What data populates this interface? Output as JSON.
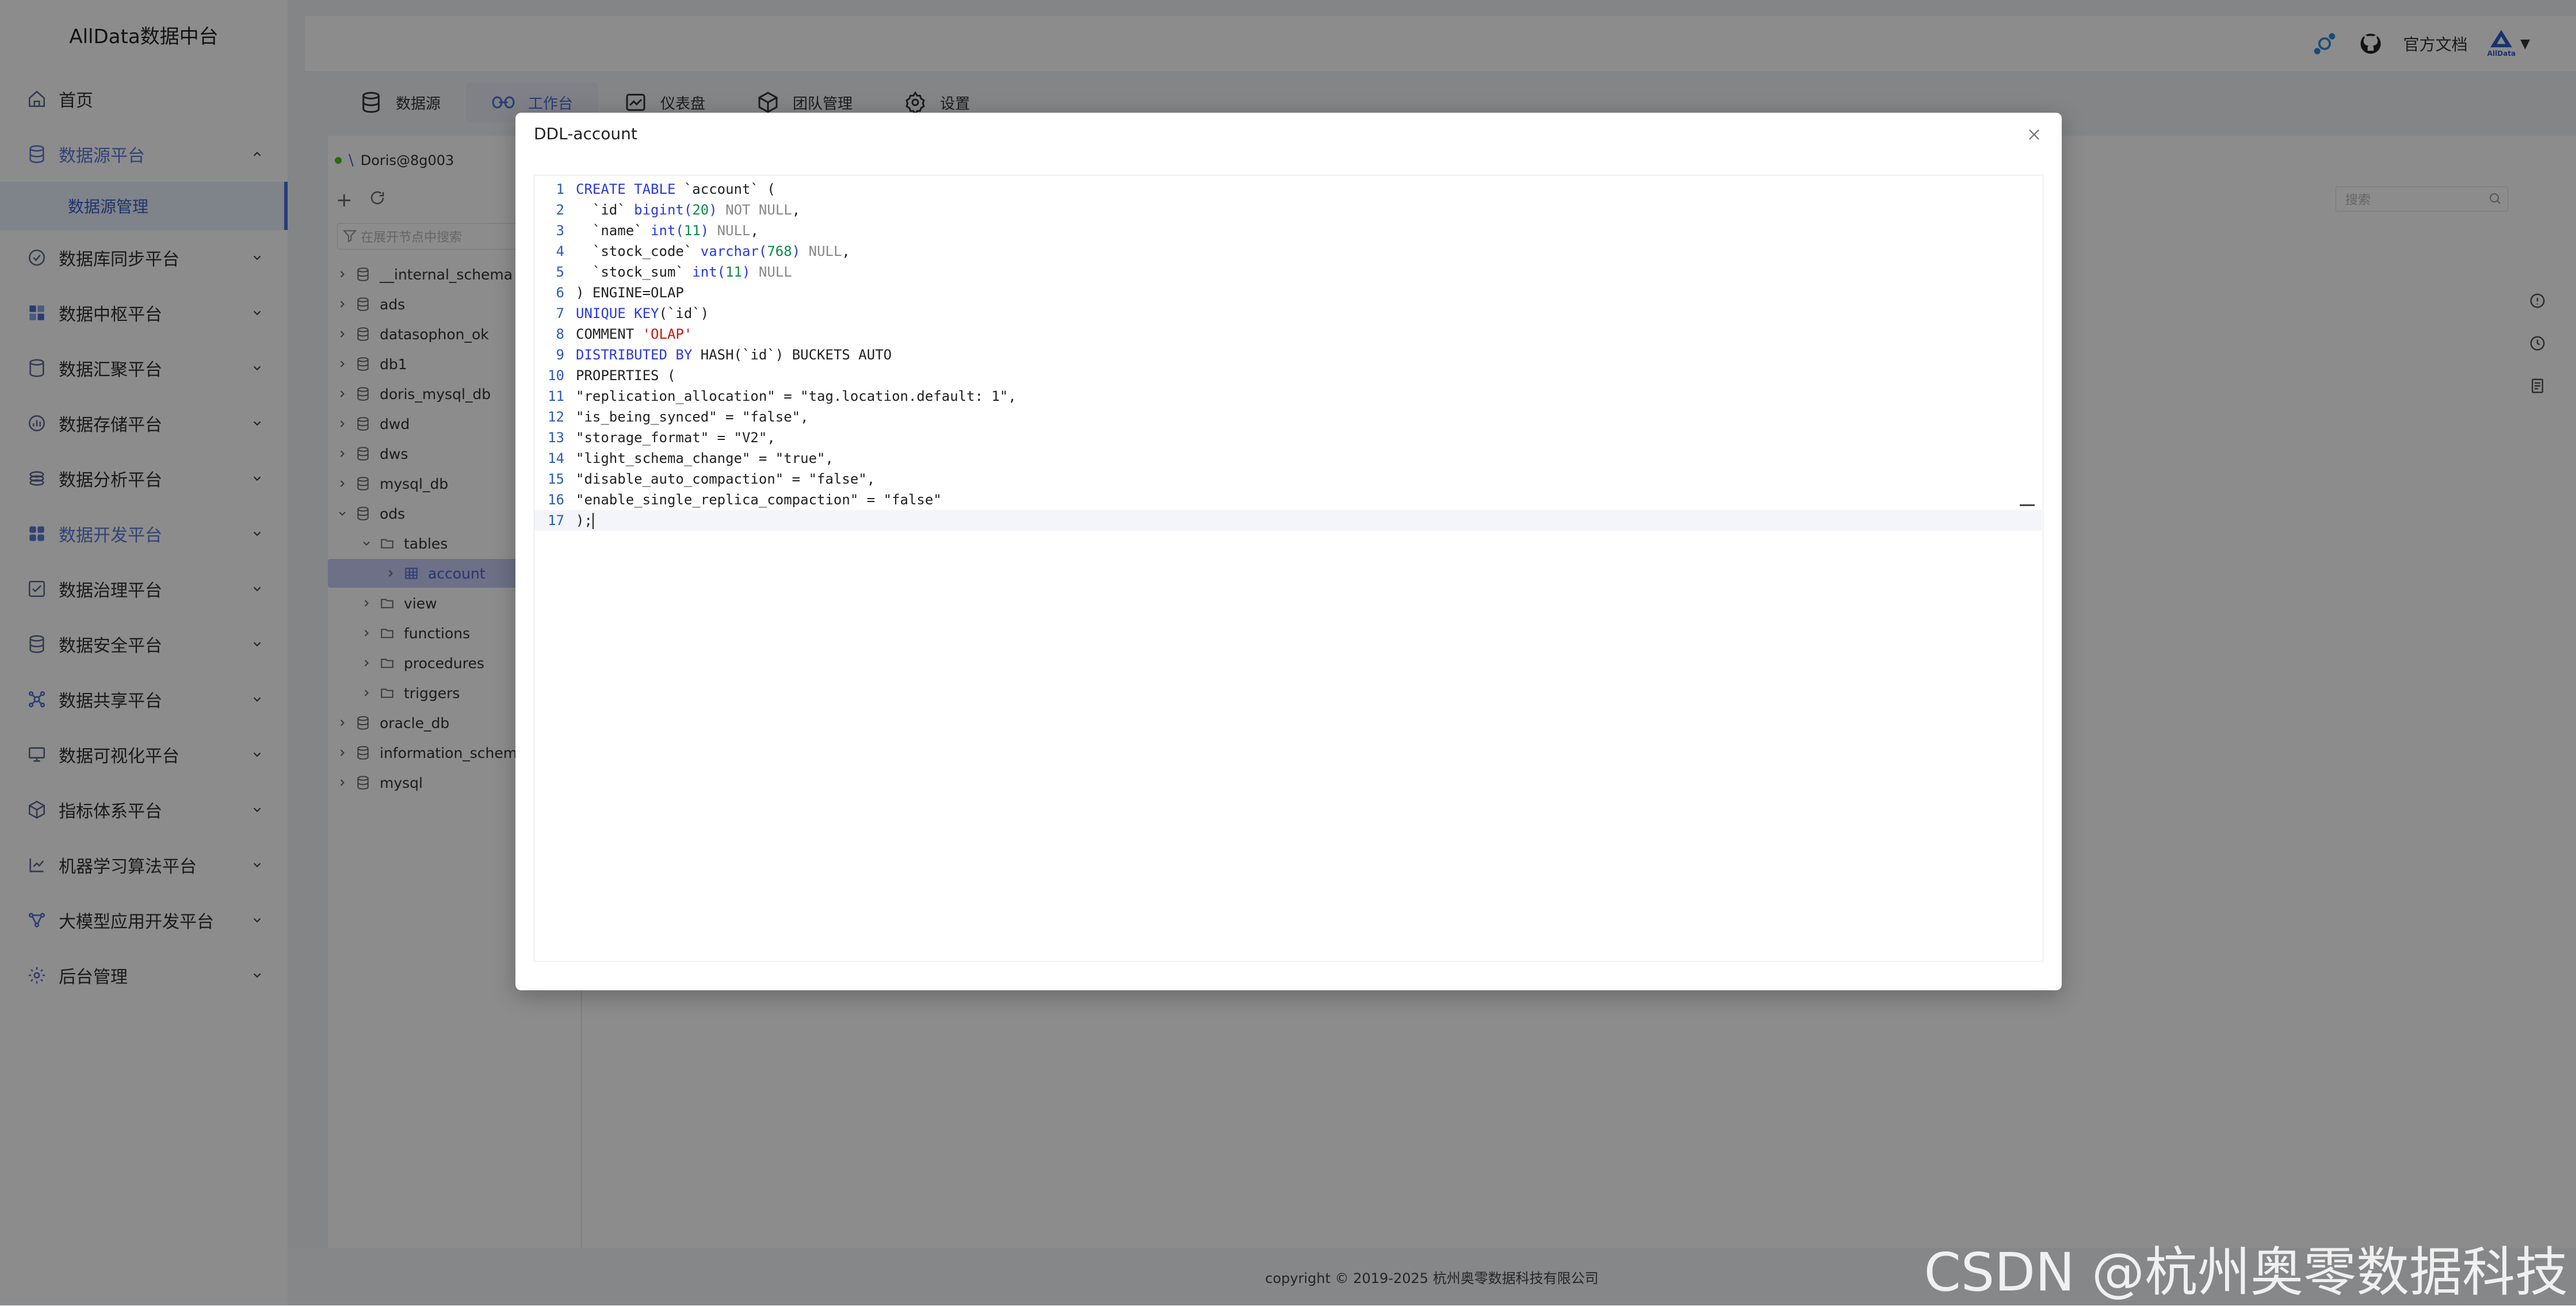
{
  "brand": "AllData数据中台",
  "sidebar": {
    "items": [
      {
        "label": "首页",
        "icon": "home-icon"
      },
      {
        "label": "数据源平台",
        "icon": "database-stack-icon",
        "expanded": true
      },
      {
        "label": "数据库同步平台",
        "icon": "sync-icon"
      },
      {
        "label": "数据中枢平台",
        "icon": "grid-icon"
      },
      {
        "label": "数据汇聚平台",
        "icon": "database-icon"
      },
      {
        "label": "数据存储平台",
        "icon": "storage-icon"
      },
      {
        "label": "数据分析平台",
        "icon": "analysis-icon"
      },
      {
        "label": "数据开发平台",
        "icon": "develop-icon"
      },
      {
        "label": "数据治理平台",
        "icon": "governance-icon"
      },
      {
        "label": "数据安全平台",
        "icon": "security-icon"
      },
      {
        "label": "数据共享平台",
        "icon": "share-icon"
      },
      {
        "label": "数据可视化平台",
        "icon": "monitor-icon"
      },
      {
        "label": "指标体系平台",
        "icon": "cube-icon"
      },
      {
        "label": "机器学习算法平台",
        "icon": "ml-icon"
      },
      {
        "label": "大模型应用开发平台",
        "icon": "network-icon"
      },
      {
        "label": "后台管理",
        "icon": "settings-icon"
      }
    ],
    "submenu": {
      "label": "数据源管理"
    }
  },
  "header": {
    "docs_label": "官方文档",
    "logo_text": "AllData"
  },
  "tabs": [
    {
      "label": "数据源",
      "icon": "database-icon"
    },
    {
      "label": "工作台",
      "icon": "workbench-icon",
      "active": true
    },
    {
      "label": "仪表盘",
      "icon": "dashboard-icon"
    },
    {
      "label": "团队管理",
      "icon": "team-icon"
    },
    {
      "label": "设置",
      "icon": "gear-icon"
    }
  ],
  "tree": {
    "connection": "Doris@8g003",
    "search_placeholder": "在展开节点中搜索",
    "nodes": [
      {
        "label": "__internal_schema",
        "level": 0,
        "open": false,
        "type": "db"
      },
      {
        "label": "ads",
        "level": 0,
        "open": false,
        "type": "db"
      },
      {
        "label": "datasophon_ok",
        "level": 0,
        "open": false,
        "type": "db"
      },
      {
        "label": "db1",
        "level": 0,
        "open": false,
        "type": "db"
      },
      {
        "label": "doris_mysql_db",
        "level": 0,
        "open": false,
        "type": "db"
      },
      {
        "label": "dwd",
        "level": 0,
        "open": false,
        "type": "db"
      },
      {
        "label": "dws",
        "level": 0,
        "open": false,
        "type": "db"
      },
      {
        "label": "mysql_db",
        "level": 0,
        "open": false,
        "type": "db"
      },
      {
        "label": "ods",
        "level": 0,
        "open": true,
        "type": "db"
      },
      {
        "label": "tables",
        "level": 1,
        "open": true,
        "type": "folder"
      },
      {
        "label": "account",
        "level": 2,
        "open": false,
        "type": "table",
        "selected": true
      },
      {
        "label": "view",
        "level": 1,
        "open": false,
        "type": "folder"
      },
      {
        "label": "functions",
        "level": 1,
        "open": false,
        "type": "folder"
      },
      {
        "label": "procedures",
        "level": 1,
        "open": false,
        "type": "folder"
      },
      {
        "label": "triggers",
        "level": 1,
        "open": false,
        "type": "folder"
      },
      {
        "label": "oracle_db",
        "level": 0,
        "open": false,
        "type": "db"
      },
      {
        "label": "information_schema",
        "level": 0,
        "open": false,
        "type": "db"
      },
      {
        "label": "mysql",
        "level": 0,
        "open": false,
        "type": "db"
      }
    ]
  },
  "content": {
    "search_placeholder": "搜索"
  },
  "footer": "copyright © 2019-2025 杭州奥零数据科技有限公司",
  "modal": {
    "title": "DDL-account",
    "code_lines": [
      {
        "n": "1",
        "t": "CREATE TABLE `account` ("
      },
      {
        "n": "2",
        "t": "  `id` bigint(20) NOT NULL,"
      },
      {
        "n": "3",
        "t": "  `name` int(11) NULL,"
      },
      {
        "n": "4",
        "t": "  `stock_code` varchar(768) NULL,"
      },
      {
        "n": "5",
        "t": "  `stock_sum` int(11) NULL"
      },
      {
        "n": "6",
        "t": ") ENGINE=OLAP"
      },
      {
        "n": "7",
        "t": "UNIQUE KEY(`id`)"
      },
      {
        "n": "8",
        "t": "COMMENT 'OLAP'"
      },
      {
        "n": "9",
        "t": "DISTRIBUTED BY HASH(`id`) BUCKETS AUTO"
      },
      {
        "n": "10",
        "t": "PROPERTIES ("
      },
      {
        "n": "11",
        "t": "\"replication_allocation\" = \"tag.location.default: 1\","
      },
      {
        "n": "12",
        "t": "\"is_being_synced\" = \"false\","
      },
      {
        "n": "13",
        "t": "\"storage_format\" = \"V2\","
      },
      {
        "n": "14",
        "t": "\"light_schema_change\" = \"true\","
      },
      {
        "n": "15",
        "t": "\"disable_auto_compaction\" = \"false\","
      },
      {
        "n": "16",
        "t": "\"enable_single_replica_compaction\" = \"false\""
      },
      {
        "n": "17",
        "t": ");"
      }
    ]
  },
  "watermark": "CSDN @杭州奥零数据科技",
  "colors": {
    "accent": "#4a6fd6",
    "keyword": "#2b3ad9",
    "number": "#0b8a4d",
    "string": "#c41a16"
  }
}
